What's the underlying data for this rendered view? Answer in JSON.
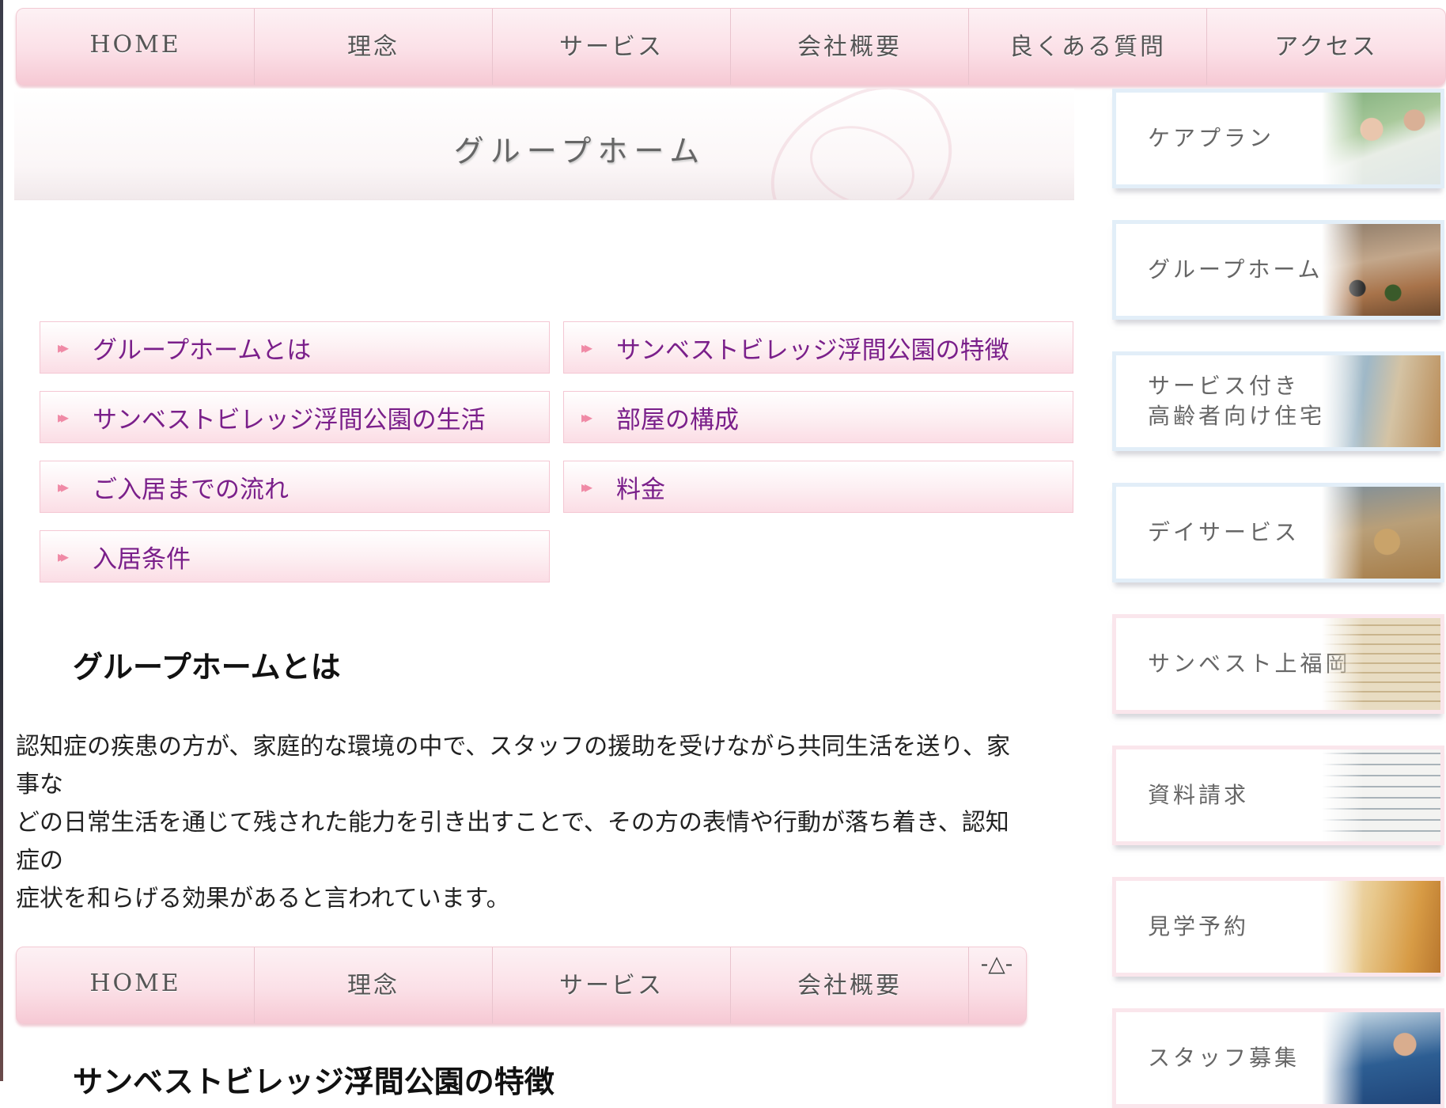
{
  "top_nav": {
    "items": [
      {
        "label": "HOME"
      },
      {
        "label": "理念"
      },
      {
        "label": "サービス"
      },
      {
        "label": "会社概要"
      },
      {
        "label": "良くある質問"
      },
      {
        "label": "アクセス"
      }
    ]
  },
  "page_title": "グループホーム",
  "section_links": [
    {
      "label": "グループホームとは"
    },
    {
      "label": "サンベストビレッジ浮間公園の特徴"
    },
    {
      "label": "サンベストビレッジ浮間公園の生活"
    },
    {
      "label": "部屋の構成"
    },
    {
      "label": "ご入居までの流れ"
    },
    {
      "label": "料金"
    },
    {
      "label": "入居条件"
    }
  ],
  "section1": {
    "heading": "グループホームとは",
    "lines": [
      "認知症の疾患の方が、家庭的な環境の中で、スタッフの援助を受けながら共同生活を送り、家",
      "事な",
      "どの日常生活を通じて残された能力を引き出すことで、その方の表情や行動が落ち着き、認知",
      "症の",
      "症状を和らげる効果があると言われています。"
    ]
  },
  "bottom_nav": {
    "items": [
      {
        "label": "HOME"
      },
      {
        "label": "理念"
      },
      {
        "label": "サービス"
      },
      {
        "label": "会社概要"
      }
    ],
    "partial_label": "-△-"
  },
  "section2": {
    "heading": "サンベストビレッジ浮間公園の特徴"
  },
  "sidebar": {
    "items": [
      {
        "label": "ケアプラン"
      },
      {
        "label": "グループホーム"
      },
      {
        "label_line1": "サービス付き",
        "label_line2": "高齢者向け住宅"
      },
      {
        "label": "デイサービス"
      },
      {
        "label": "サンベスト上福岡"
      },
      {
        "label": "資料請求"
      },
      {
        "label": "見学予約"
      },
      {
        "label": "スタッフ募集"
      }
    ]
  }
}
